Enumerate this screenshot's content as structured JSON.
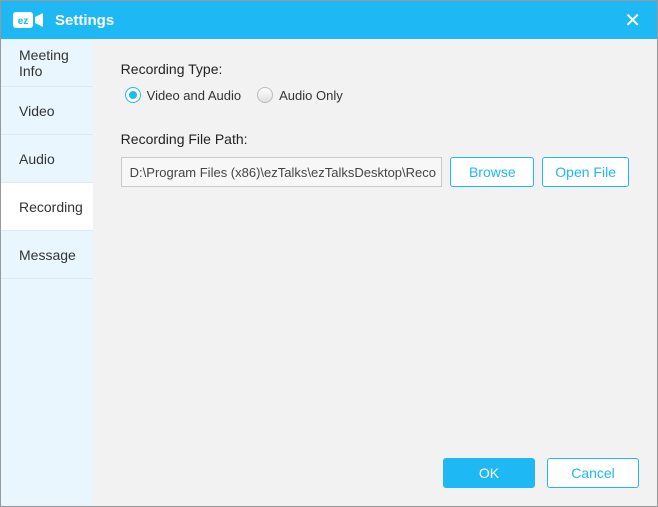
{
  "titlebar": {
    "title": "Settings",
    "closeGlyph": "✕"
  },
  "sidebar": {
    "items": [
      {
        "label": "Meeting Info"
      },
      {
        "label": "Video"
      },
      {
        "label": "Audio"
      },
      {
        "label": "Recording"
      },
      {
        "label": "Message"
      }
    ],
    "activeIndex": 3
  },
  "content": {
    "recordingTypeLabel": "Recording Type:",
    "radios": {
      "videoAndAudio": "Video and Audio",
      "audioOnly": "Audio Only"
    },
    "selectedRadio": "videoAndAudio",
    "filePathLabel": "Recording File Path:",
    "filePathValue": "D:\\Program Files (x86)\\ezTalks\\ezTalksDesktop\\Reco",
    "browseLabel": "Browse",
    "openFileLabel": "Open File"
  },
  "footer": {
    "okLabel": "OK",
    "cancelLabel": "Cancel"
  }
}
